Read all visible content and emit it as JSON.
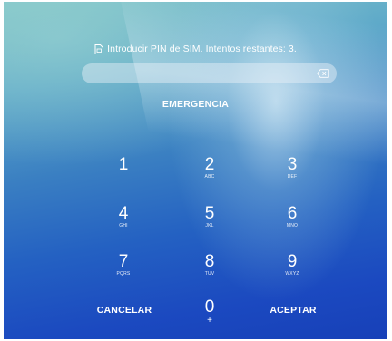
{
  "sim_message": {
    "icon": "sim-card-icon",
    "text": "Introducir PIN de SIM. Intentos restantes: 3."
  },
  "pin_input": {
    "value": "",
    "placeholder": "",
    "clear_icon": "backspace-icon"
  },
  "emergency_label": "EMERGENCIA",
  "keypad": {
    "keys": [
      {
        "digit": "1",
        "letters": ""
      },
      {
        "digit": "2",
        "letters": "ABC"
      },
      {
        "digit": "3",
        "letters": "DEF"
      },
      {
        "digit": "4",
        "letters": "GHI"
      },
      {
        "digit": "5",
        "letters": "JKL"
      },
      {
        "digit": "6",
        "letters": "MNO"
      },
      {
        "digit": "7",
        "letters": "PQRS"
      },
      {
        "digit": "8",
        "letters": "TUV"
      },
      {
        "digit": "9",
        "letters": "WXYZ"
      },
      {
        "digit": "0",
        "letters": "+"
      }
    ],
    "cancel_label": "CANCELAR",
    "ok_label": "ACEPTAR"
  }
}
